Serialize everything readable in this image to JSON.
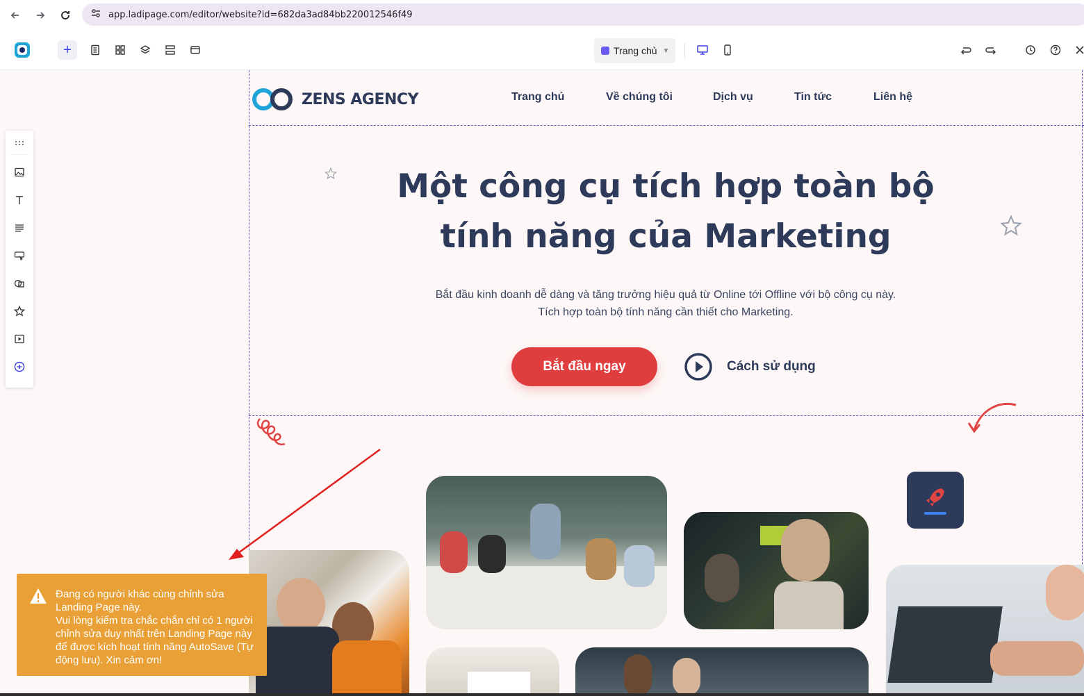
{
  "browser": {
    "url": "app.ladipage.com/editor/website?id=682da3ad84bb220012546f49"
  },
  "toolbar": {
    "page_selector": "Trang chủ"
  },
  "site": {
    "brand": "ZENS AGENCY",
    "nav": [
      "Trang chủ",
      "Về chúng tôi",
      "Dịch vụ",
      "Tin tức",
      "Liên hệ"
    ],
    "hero_title_line1": "Một công cụ tích hợp toàn bộ",
    "hero_title_line2": "tính năng của Marketing",
    "hero_sub_line1": "Bắt đầu kinh doanh dễ dàng và tăng trưởng hiệu quả từ Online tới Offline với bộ công cụ này.",
    "hero_sub_line2": "Tích hợp toàn bộ tính năng cần thiết cho Marketing.",
    "cta_label": "Bắt đầu ngay",
    "how_label": "Cách sử dụng"
  },
  "toast": {
    "line1": "Đang có người khác cùng chỉnh sửa Landing Page này.",
    "line2": "Vui lòng kiểm tra chắc chắn chỉ có 1 người chỉnh sửa duy nhất trên Landing Page này để được kích hoạt tính năng AutoSave (Tự động lưu). Xin cảm ơn!"
  },
  "colors": {
    "brand_navy": "#2e3a59",
    "cta_red": "#e03e3e",
    "toast_orange": "#e9a036",
    "editor_accent": "#3a3ee0"
  },
  "icons": [
    "back-icon",
    "forward-icon",
    "reload-icon",
    "site-info-icon",
    "app-logo-icon",
    "add-icon",
    "pages-icon",
    "sections-icon",
    "layers-icon",
    "rows-icon",
    "popup-icon",
    "desktop-icon",
    "mobile-icon",
    "undo-icon",
    "redo-icon",
    "history-icon",
    "help-icon",
    "tools-icon",
    "drag-icon",
    "image-icon",
    "text-icon",
    "paragraph-icon",
    "button-icon",
    "shape-icon",
    "star-icon",
    "video-icon",
    "more-icon",
    "play-icon",
    "rocket-icon",
    "warning-icon"
  ]
}
